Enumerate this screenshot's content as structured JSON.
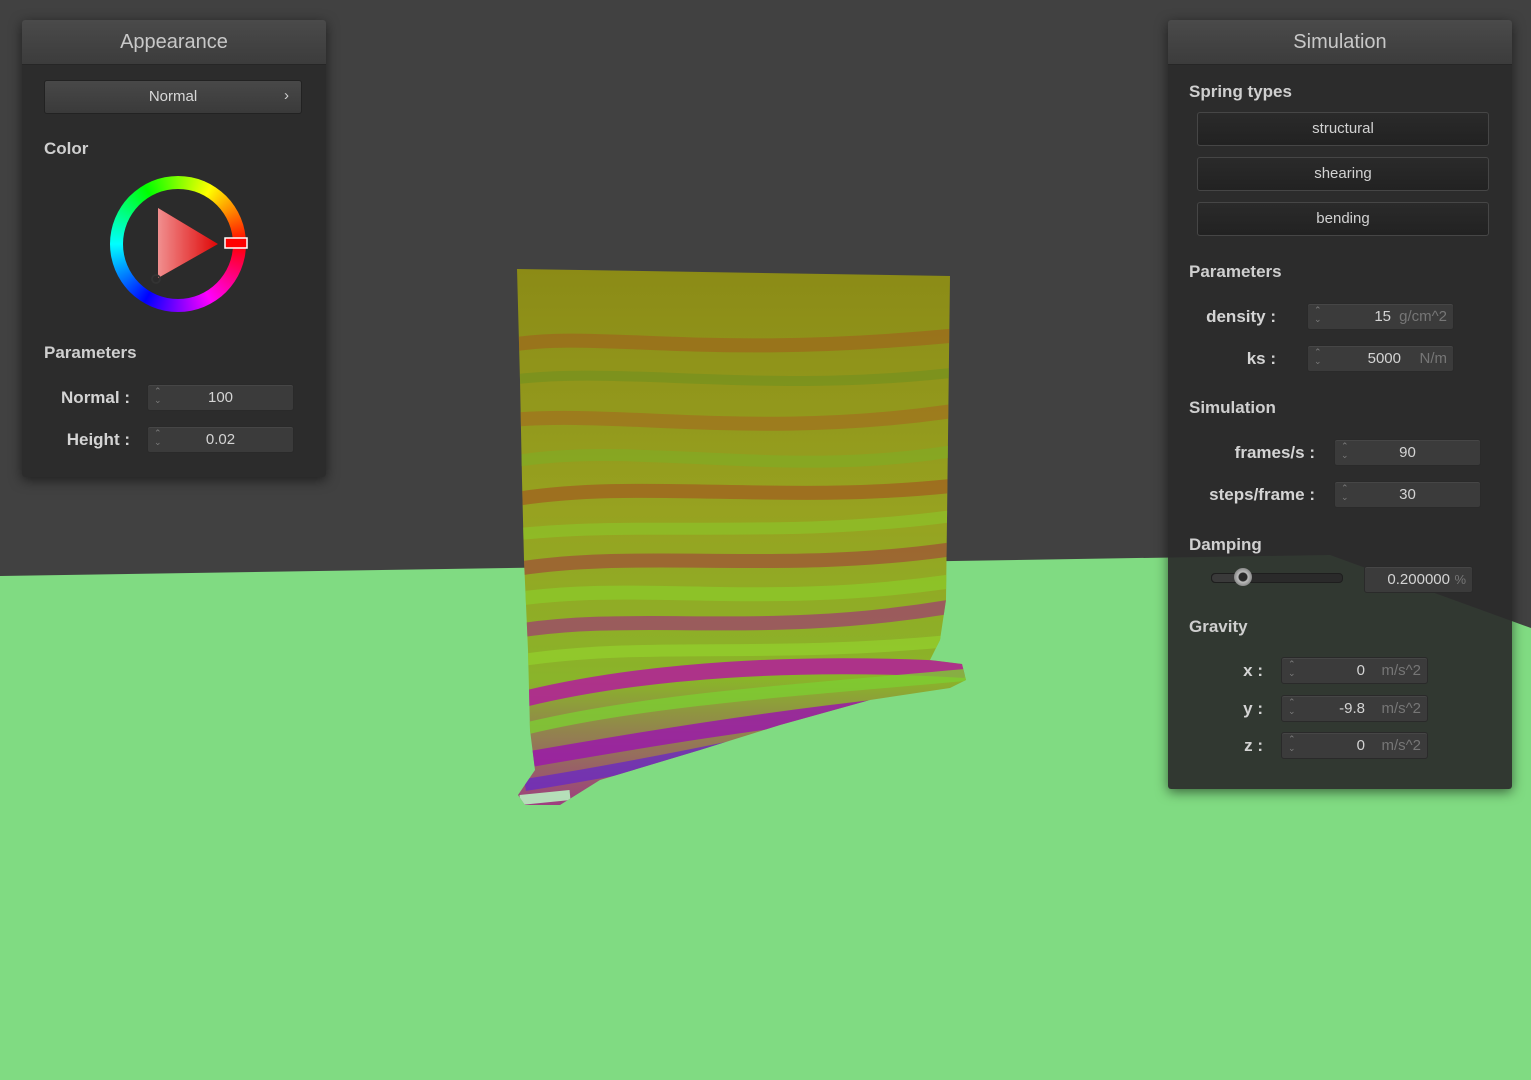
{
  "appearance": {
    "title": "Appearance",
    "mode_button": "Normal",
    "mode_chevron": "›",
    "color_label": "Color",
    "color_wheel_icon": "color-wheel-icon",
    "selected_hue": "#ff0000",
    "params_label": "Parameters",
    "normal_label": "Normal :",
    "normal_value": "100",
    "height_label": "Height :",
    "height_value": "0.02"
  },
  "simulation": {
    "title": "Simulation",
    "spring_types_label": "Spring types",
    "spring_buttons": [
      "structural",
      "shearing",
      "bending"
    ],
    "params_label": "Parameters",
    "density_label": "density :",
    "density_value": "15",
    "density_unit": "g/cm^2",
    "ks_label": "ks :",
    "ks_value": "5000",
    "ks_unit": "N/m",
    "sim_label": "Simulation",
    "fps_label": "frames/s :",
    "fps_value": "90",
    "steps_label": "steps/frame :",
    "steps_value": "30",
    "damping_label": "Damping",
    "damping_value": "0.200000",
    "damping_unit": "%",
    "damping_fraction": 0.2,
    "gravity_label": "Gravity",
    "gx_label": "x :",
    "gx_value": "0",
    "gy_label": "y :",
    "gy_value": "-9.8",
    "gz_label": "z :",
    "gz_value": "0",
    "gravity_unit": "m/s^2"
  },
  "scene": {
    "floor_color": "#80db82",
    "background_color": "#414141"
  },
  "spinner_glyph": "⌃⌄"
}
